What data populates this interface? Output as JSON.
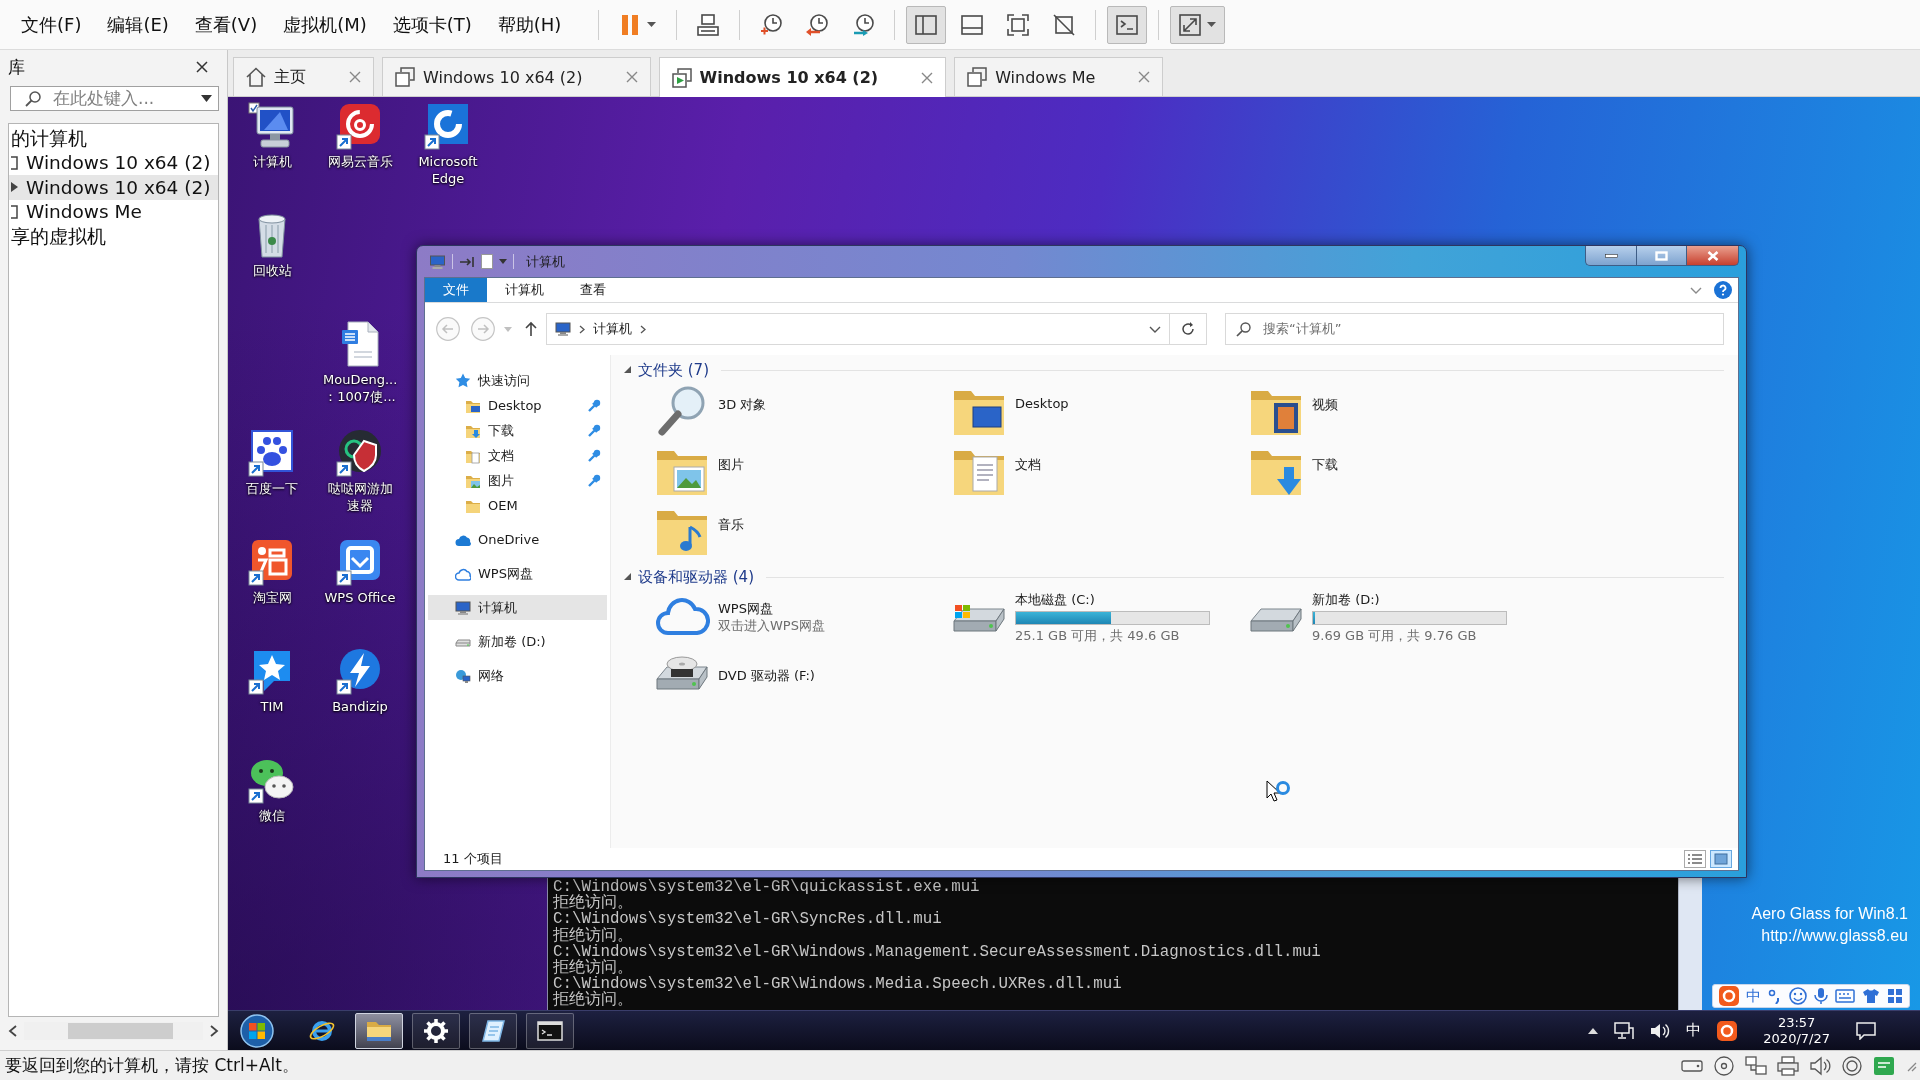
{
  "menu_bar": {
    "items": [
      "文件(F)",
      "编辑(E)",
      "查看(V)",
      "虚拟机(M)",
      "选项卡(T)",
      "帮助(H)"
    ]
  },
  "toolbar": {
    "groups": [
      [
        {
          "kind": "pause",
          "pressed": false,
          "dropdown": true
        }
      ],
      [
        {
          "kind": "send-keys",
          "pressed": false,
          "dropdown": false
        }
      ],
      [
        {
          "kind": "snapshot",
          "pressed": false,
          "dropdown": false
        },
        {
          "kind": "revert",
          "pressed": false,
          "dropdown": false
        },
        {
          "kind": "snapshot-manager",
          "pressed": false,
          "dropdown": false
        }
      ],
      [
        {
          "kind": "library",
          "pressed": true,
          "dropdown": false
        },
        {
          "kind": "thumbnails",
          "pressed": false,
          "dropdown": false
        },
        {
          "kind": "full-screen",
          "pressed": false,
          "dropdown": false
        },
        {
          "kind": "unity",
          "pressed": false,
          "dropdown": false
        }
      ],
      [
        {
          "kind": "console",
          "pressed": true,
          "dropdown": false
        }
      ],
      [
        {
          "kind": "stretch",
          "pressed": true,
          "dropdown": true
        }
      ]
    ]
  },
  "library": {
    "title": "库",
    "search": {
      "placeholder": "在此处键入..."
    },
    "tree": [
      {
        "label": "的计算机",
        "selected": false,
        "children": [
          {
            "label": "Windows 10 x64 (2)",
            "running": false,
            "selected": false
          },
          {
            "label": "Windows 10 x64 (2)",
            "running": true,
            "selected": true
          },
          {
            "label": "Windows Me",
            "running": false,
            "selected": false
          }
        ]
      },
      {
        "label": "享的虚拟机",
        "selected": false
      }
    ]
  },
  "tabs": [
    {
      "label": "主页",
      "kind": "home",
      "selected": false
    },
    {
      "label": "Windows 10 x64 (2)",
      "kind": "vm",
      "running": false,
      "selected": false
    },
    {
      "label": "Windows 10 x64 (2)",
      "kind": "vm",
      "running": true,
      "selected": true
    },
    {
      "label": "Windows Me",
      "kind": "vm",
      "running": false,
      "selected": false
    }
  ],
  "desktop": {
    "icons": [
      {
        "label": "计算机",
        "kind": "computer",
        "shortcut": false
      },
      {
        "label": "网易云音乐",
        "kind": "music",
        "shortcut": true
      },
      {
        "label": "Microsoft Edge",
        "kind": "edge",
        "shortcut": true
      },
      {
        "label": "回收站",
        "kind": "recycle-bin",
        "shortcut": false
      },
      {
        "label": "MouDeng...\n：1007使...",
        "kind": "document",
        "shortcut": false
      },
      {
        "label": "百度一下",
        "kind": "paw",
        "shortcut": true
      },
      {
        "label": "哒哒网游加速器",
        "kind": "accelerator",
        "shortcut": true
      },
      {
        "label": "淘宝网",
        "kind": "taobao",
        "shortcut": true
      },
      {
        "label": "WPS Office",
        "kind": "wps",
        "shortcut": true
      },
      {
        "label": "TIM",
        "kind": "tim",
        "shortcut": true
      },
      {
        "label": "Bandizip",
        "kind": "bandizip",
        "shortcut": true
      },
      {
        "label": "微信",
        "kind": "wechat",
        "shortcut": true
      }
    ],
    "watermark": [
      "Aero Glass for Win8.1",
      "http://www.glass8.eu"
    ]
  },
  "explorer": {
    "title": "计算机",
    "ribbon_tabs": [
      {
        "label": "文件",
        "selected": true
      },
      {
        "label": "计算机",
        "selected": false
      },
      {
        "label": "查看",
        "selected": false
      }
    ],
    "address": [
      "计算机"
    ],
    "search": {
      "placeholder": "搜索“计算机”"
    },
    "nav": [
      {
        "label": "快速访问",
        "kind": "star",
        "selected": false,
        "children": [
          {
            "label": "Desktop",
            "kind": "desktop",
            "pinned": true,
            "selected": false
          },
          {
            "label": "下载",
            "kind": "downloads",
            "pinned": true,
            "selected": false
          },
          {
            "label": "文档",
            "kind": "documents",
            "pinned": true,
            "selected": false
          },
          {
            "label": "图片",
            "kind": "pictures",
            "pinned": true,
            "selected": false
          },
          {
            "label": "OEM",
            "kind": "folder",
            "pinned": false,
            "selected": false
          }
        ]
      },
      {
        "label": "OneDrive",
        "kind": "onedrive",
        "selected": false
      },
      {
        "label": "WPS网盘",
        "kind": "cloud",
        "selected": false
      },
      {
        "label": "计算机",
        "kind": "computer",
        "selected": true
      },
      {
        "label": "新加卷 (D:)",
        "kind": "drive",
        "selected": false
      },
      {
        "label": "网络",
        "kind": "network",
        "selected": false
      }
    ],
    "groups": [
      {
        "title": "文件夹 (7)",
        "expanded": true,
        "items": [
          {
            "label": "3D 对象",
            "kind": "objects"
          },
          {
            "label": "Desktop",
            "kind": "desktop"
          },
          {
            "label": "视频",
            "kind": "videos"
          },
          {
            "label": "图片",
            "kind": "pictures"
          },
          {
            "label": "文档",
            "kind": "documents"
          },
          {
            "label": "下载",
            "kind": "downloads"
          },
          {
            "label": "音乐",
            "kind": "music"
          }
        ]
      },
      {
        "title": "设备和驱动器 (4)",
        "expanded": true,
        "items": [
          {
            "label": "WPS网盘",
            "kind": "cloud",
            "detail": "双击进入WPS网盘"
          },
          {
            "label": "本地磁盘 (C:)",
            "kind": "system-drive",
            "level": 0.49,
            "detail": "25.1 GB 可用，共 49.6 GB"
          },
          {
            "label": "新加卷 (D:)",
            "kind": "drive",
            "level": 0.01,
            "detail": "9.69 GB 可用，共 9.76 GB"
          },
          {
            "label": "DVD 驱动器 (F:)",
            "kind": "dvd"
          }
        ]
      }
    ],
    "status": "11 个项目",
    "views": [
      {
        "kind": "details",
        "selected": false
      },
      {
        "kind": "large-icons",
        "selected": true
      }
    ]
  },
  "console": {
    "lines": [
      "C:\\Windows\\system32\\el-GR\\quickassist.exe.mui",
      "拒绝访问。",
      "C:\\Windows\\system32\\el-GR\\SyncRes.dll.mui",
      "拒绝访问。",
      "C:\\Windows\\system32\\el-GR\\Windows.Management.SecureAssessment.Diagnostics.dll.mui",
      "拒绝访问。",
      "C:\\Windows\\system32\\el-GR\\Windows.Media.Speech.UXRes.dll.mui",
      "拒绝访问。"
    ]
  },
  "ime_toolbar": {
    "mode": "中"
  },
  "taskbar": {
    "apps": [
      {
        "kind": "ie",
        "running": false,
        "active": false
      },
      {
        "kind": "explorer",
        "running": true,
        "active": true
      },
      {
        "kind": "settings",
        "running": true,
        "active": false
      },
      {
        "kind": "app",
        "running": true,
        "active": false
      },
      {
        "kind": "cmd",
        "running": true,
        "active": false
      }
    ],
    "tray": {
      "input_mode": "中",
      "time": "23:57",
      "date": "2020/7/27"
    }
  },
  "status_bar": {
    "message": "要返回到您的计算机，请按 Ctrl+Alt。",
    "devices": [
      {
        "kind": "hdd"
      },
      {
        "kind": "cd"
      },
      {
        "kind": "network"
      },
      {
        "kind": "printer"
      },
      {
        "kind": "sound"
      },
      {
        "kind": "disc"
      },
      {
        "kind": "message"
      }
    ]
  }
}
